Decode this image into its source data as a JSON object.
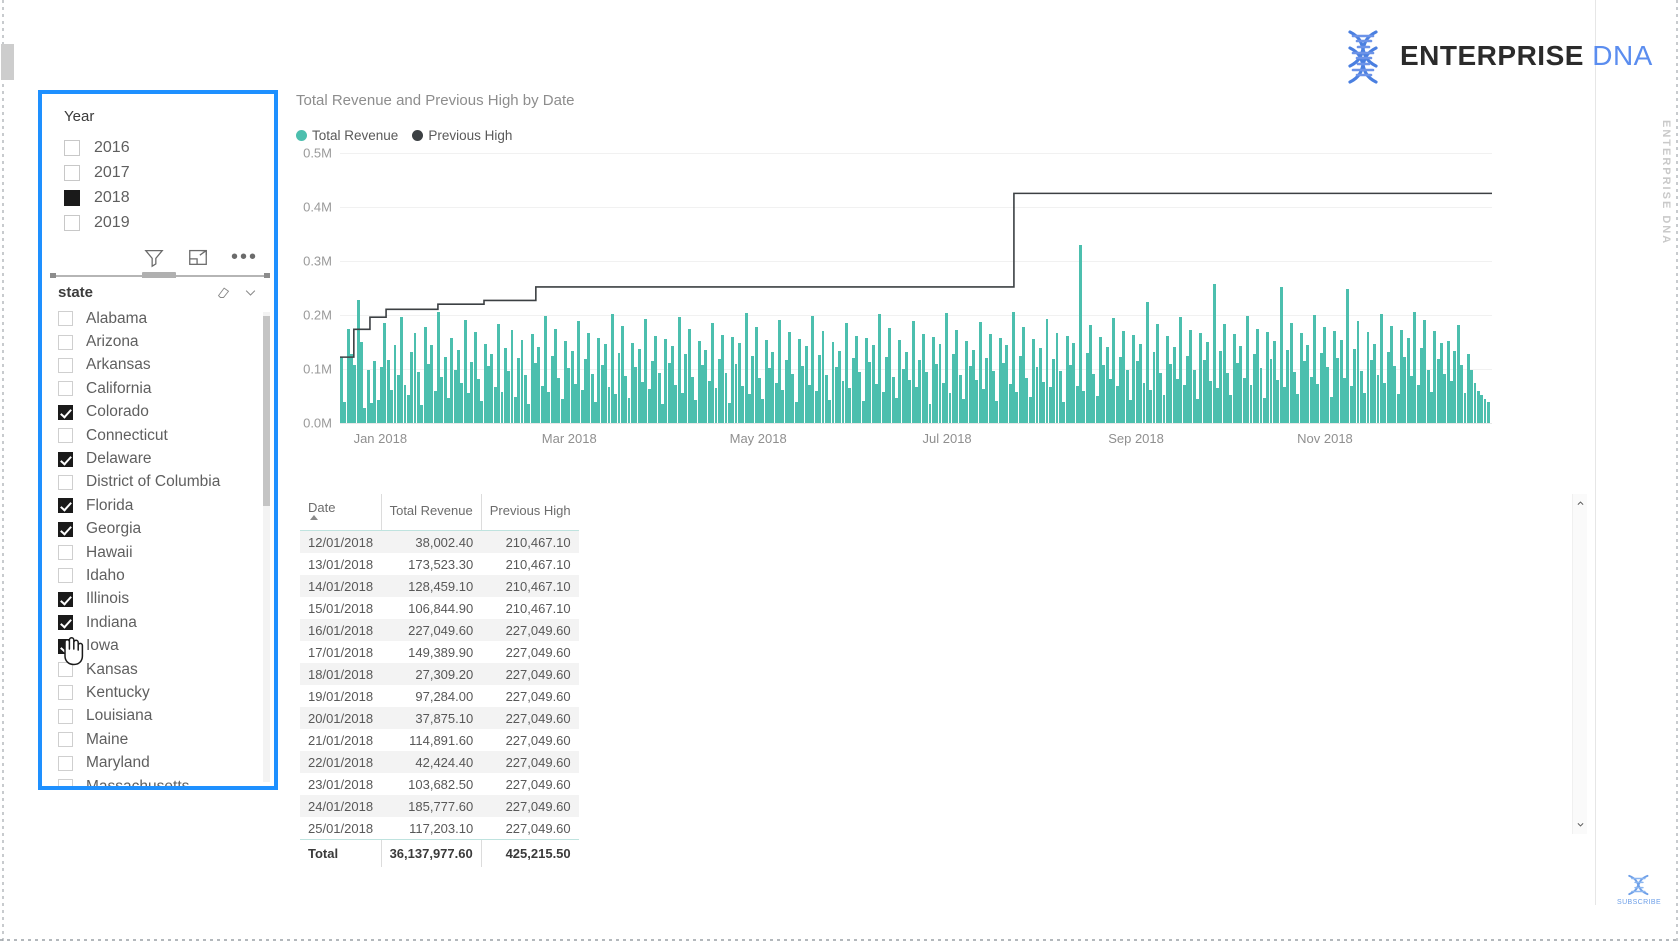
{
  "brand": {
    "logo_primary": "ENTERPRISE",
    "logo_secondary": "DNA",
    "logo_icon": "dna-helix-icon",
    "primary_color": "#2b2b2b",
    "secondary_color": "#5b8def",
    "side_vert_text": "ENTERPRISE DNA",
    "subscribe_label": "SUBSCRIBE"
  },
  "year_slicer": {
    "title": "Year",
    "selection_border_color": "#1e90ff",
    "items": [
      {
        "label": "2016",
        "checked": false
      },
      {
        "label": "2017",
        "checked": false
      },
      {
        "label": "2018",
        "checked": true
      },
      {
        "label": "2019",
        "checked": false
      }
    ],
    "icons": [
      "filter-icon",
      "focus-mode-icon",
      "more-options-icon"
    ]
  },
  "state_slicer": {
    "title": "state",
    "icons": [
      "clear-selection-icon",
      "chevron-down-icon"
    ],
    "items": [
      {
        "label": "Alabama",
        "checked": false
      },
      {
        "label": "Arizona",
        "checked": false
      },
      {
        "label": "Arkansas",
        "checked": false
      },
      {
        "label": "California",
        "checked": false
      },
      {
        "label": "Colorado",
        "checked": true
      },
      {
        "label": "Connecticut",
        "checked": false
      },
      {
        "label": "Delaware",
        "checked": true
      },
      {
        "label": "District of Columbia",
        "checked": false
      },
      {
        "label": "Florida",
        "checked": true
      },
      {
        "label": "Georgia",
        "checked": true
      },
      {
        "label": "Hawaii",
        "checked": false
      },
      {
        "label": "Idaho",
        "checked": false
      },
      {
        "label": "Illinois",
        "checked": true
      },
      {
        "label": "Indiana",
        "checked": true
      },
      {
        "label": "Iowa",
        "checked": true
      },
      {
        "label": "Kansas",
        "checked": false
      },
      {
        "label": "Kentucky",
        "checked": false
      },
      {
        "label": "Louisiana",
        "checked": false
      },
      {
        "label": "Maine",
        "checked": false
      },
      {
        "label": "Maryland",
        "checked": false
      },
      {
        "label": "Massachusetts",
        "checked": false
      }
    ]
  },
  "chart_data": {
    "type": "bar",
    "title": "Total Revenue and Previous High by Date",
    "xlabel": "",
    "ylabel": "",
    "ylim": [
      0,
      500000
    ],
    "grid": true,
    "legend_position": "top-left",
    "y_ticks": [
      "0.0M",
      "0.1M",
      "0.2M",
      "0.3M",
      "0.4M",
      "0.5M"
    ],
    "y_tick_values": [
      0,
      100000,
      200000,
      300000,
      400000,
      500000
    ],
    "x_ticks": [
      "Jan 2018",
      "Mar 2018",
      "May 2018",
      "Jul 2018",
      "Sep 2018",
      "Nov 2018"
    ],
    "colors": {
      "total_revenue": "#4cbfae",
      "previous_high": "#3c4043"
    },
    "series": [
      {
        "name": "Total Revenue",
        "type": "bar",
        "color": "#4cbfae",
        "values": [
          122000,
          38002,
          173523,
          128459,
          106845,
          227050,
          149390,
          27309,
          97284,
          37875,
          114892,
          42424,
          103683,
          185778,
          117203,
          62000,
          145000,
          88000,
          196000,
          71000,
          52000,
          131000,
          167000,
          94000,
          33000,
          178000,
          109000,
          144000,
          60000,
          205000,
          86000,
          122000,
          47000,
          158000,
          99000,
          136000,
          74000,
          191000,
          55000,
          113000,
          169000,
          82000,
          41000,
          147000,
          105000,
          128000,
          66000,
          183000,
          57000,
          139000,
          96000,
          172000,
          48000,
          121000,
          153000,
          89000,
          36000,
          164000,
          111000,
          141000,
          69000,
          198000,
          58000,
          125000,
          175000,
          84000,
          44000,
          152000,
          101000,
          133000,
          72000,
          188000,
          61000,
          118000,
          166000,
          91000,
          39000,
          157000,
          107000,
          146000,
          67000,
          202000,
          54000,
          129000,
          179000,
          87000,
          46000,
          149000,
          103000,
          137000,
          76000,
          193000,
          63000,
          115000,
          161000,
          93000,
          35000,
          155000,
          112000,
          143000,
          70000,
          197000,
          56000,
          127000,
          174000,
          85000,
          43000,
          151000,
          108000,
          135000,
          78000,
          186000,
          64000,
          119000,
          163000,
          92000,
          37000,
          159000,
          110000,
          148000,
          68000,
          204000,
          53000,
          124000,
          177000,
          83000,
          45000,
          154000,
          102000,
          132000,
          75000,
          190000,
          62000,
          117000,
          168000,
          90000,
          38000,
          156000,
          106000,
          142000,
          71000,
          199000,
          59000,
          126000,
          171000,
          88000,
          42000,
          150000,
          104000,
          134000,
          77000,
          185000,
          65000,
          120000,
          162000,
          95000,
          40000,
          158000,
          113000,
          145000,
          73000,
          201000,
          57000,
          123000,
          176000,
          86000,
          47000,
          153000,
          100000,
          131000,
          79000,
          189000,
          66000,
          116000,
          165000,
          94000,
          36000,
          160000,
          109000,
          147000,
          74000,
          203000,
          55000,
          128000,
          173000,
          89000,
          44000,
          152000,
          105000,
          136000,
          80000,
          187000,
          63000,
          121000,
          164000,
          96000,
          41000,
          157000,
          111000,
          144000,
          72000,
          206000,
          58000,
          125000,
          178000,
          84000,
          48000,
          155000,
          103000,
          138000,
          76000,
          192000,
          67000,
          118000,
          167000,
          97000,
          39000,
          161000,
          108000,
          149000,
          69000,
          330000,
          60000,
          130000,
          181000,
          91000,
          50000,
          159000,
          107000,
          140000,
          81000,
          195000,
          68000,
          122000,
          170000,
          98000,
          43000,
          163000,
          114000,
          146000,
          75000,
          225000,
          61000,
          131000,
          183000,
          92000,
          51000,
          162000,
          109000,
          141000,
          82000,
          196000,
          70000,
          124000,
          172000,
          99000,
          45000,
          166000,
          116000,
          150000,
          78000,
          258000,
          64000,
          133000,
          184000,
          93000,
          52000,
          165000,
          112000,
          143000,
          83000,
          198000,
          71000,
          127000,
          175000,
          101000,
          46000,
          168000,
          118000,
          152000,
          80000,
          252000,
          66000,
          135000,
          186000,
          95000,
          54000,
          167000,
          115000,
          145000,
          85000,
          200000,
          73000,
          129000,
          177000,
          103000,
          49000,
          170000,
          120000,
          154000,
          84000,
          248000,
          68000,
          137000,
          188000,
          97000,
          56000,
          169000,
          117000,
          147000,
          88000,
          202000,
          75000,
          132000,
          179000,
          105000,
          53000,
          173000,
          122000,
          157000,
          87000,
          205000,
          70000,
          139000,
          190000,
          99000,
          58000,
          171000,
          119000,
          149000,
          90000,
          152000,
          77000,
          134000,
          181000,
          107000,
          55000,
          128000,
          98000,
          75000,
          60000,
          52000,
          44000,
          38000
        ]
      },
      {
        "name": "Previous High",
        "type": "line",
        "color": "#3c4043",
        "step": true,
        "final_value": 425215.5,
        "steps": [
          {
            "x_pct": 0.0,
            "value": 122000
          },
          {
            "x_pct": 1.2,
            "value": 173523
          },
          {
            "x_pct": 2.6,
            "value": 196000
          },
          {
            "x_pct": 4.0,
            "value": 210467
          },
          {
            "x_pct": 8.5,
            "value": 220000
          },
          {
            "x_pct": 12.5,
            "value": 227050
          },
          {
            "x_pct": 17.0,
            "value": 252000
          },
          {
            "x_pct": 58.5,
            "value": 425216
          },
          {
            "x_pct": 100.0,
            "value": 425216
          }
        ]
      }
    ]
  },
  "table": {
    "columns": [
      "Date",
      "Total Revenue",
      "Previous High"
    ],
    "sort_column": "Date",
    "sort_direction": "ascending",
    "rows": [
      {
        "date": "12/01/2018",
        "total_revenue": "38,002.40",
        "previous_high": "210,467.10"
      },
      {
        "date": "13/01/2018",
        "total_revenue": "173,523.30",
        "previous_high": "210,467.10"
      },
      {
        "date": "14/01/2018",
        "total_revenue": "128,459.10",
        "previous_high": "210,467.10"
      },
      {
        "date": "15/01/2018",
        "total_revenue": "106,844.90",
        "previous_high": "210,467.10"
      },
      {
        "date": "16/01/2018",
        "total_revenue": "227,049.60",
        "previous_high": "227,049.60"
      },
      {
        "date": "17/01/2018",
        "total_revenue": "149,389.90",
        "previous_high": "227,049.60"
      },
      {
        "date": "18/01/2018",
        "total_revenue": "27,309.20",
        "previous_high": "227,049.60"
      },
      {
        "date": "19/01/2018",
        "total_revenue": "97,284.00",
        "previous_high": "227,049.60"
      },
      {
        "date": "20/01/2018",
        "total_revenue": "37,875.10",
        "previous_high": "227,049.60"
      },
      {
        "date": "21/01/2018",
        "total_revenue": "114,891.60",
        "previous_high": "227,049.60"
      },
      {
        "date": "22/01/2018",
        "total_revenue": "42,424.40",
        "previous_high": "227,049.60"
      },
      {
        "date": "23/01/2018",
        "total_revenue": "103,682.50",
        "previous_high": "227,049.60"
      },
      {
        "date": "24/01/2018",
        "total_revenue": "185,777.60",
        "previous_high": "227,049.60"
      },
      {
        "date": "25/01/2018",
        "total_revenue": "117,203.10",
        "previous_high": "227,049.60"
      }
    ],
    "total_row": {
      "date": "Total",
      "total_revenue": "36,137,977.60",
      "previous_high": "425,215.50"
    }
  }
}
